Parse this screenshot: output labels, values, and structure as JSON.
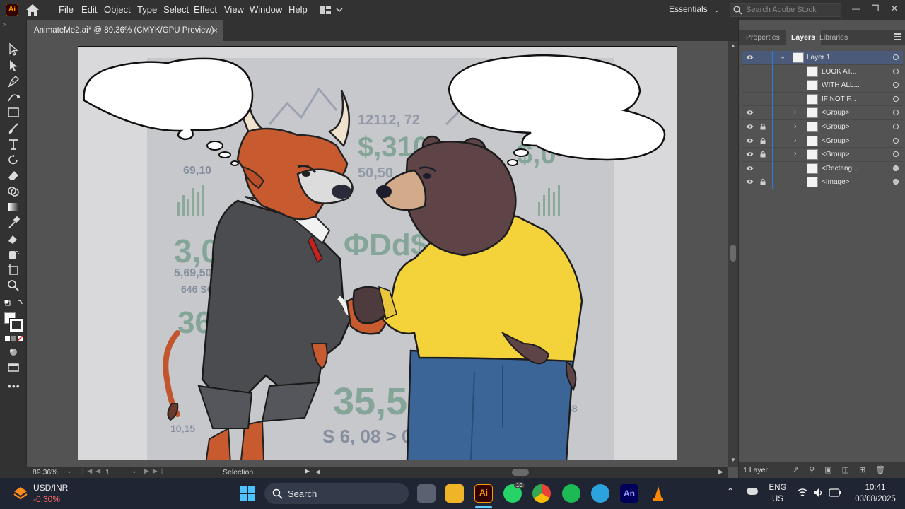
{
  "app": {
    "logo": "Ai",
    "menu": [
      "File",
      "Edit",
      "Object",
      "Type",
      "Select",
      "Effect",
      "View",
      "Window",
      "Help"
    ],
    "workspace": "Essentials",
    "stock_search_placeholder": "Search Adobe Stock"
  },
  "document": {
    "tab_title": "AnimateMe2.ai* @ 89.36% (CMYK/GPU Preview)",
    "close_glyph": "×"
  },
  "artwork": {
    "chart_text": [
      "12112, 72",
      "$,310",
      "50,50",
      "$,0",
      "69,10",
      "3,00",
      "5,69,50",
      "646 SO",
      "36",
      "ΦDd$",
      "35,56",
      "S 6, 08 > 0",
      "48",
      "10,15"
    ]
  },
  "status": {
    "zoom": "89.36%",
    "artboard_number": "1",
    "tool": "Selection"
  },
  "panel": {
    "tabs": [
      "Properties",
      "Layers",
      "Libraries"
    ],
    "active_tab": "Layers",
    "layers": [
      {
        "name": "Layer 1",
        "visible": true,
        "locked": false,
        "expand": "v",
        "indent": 0
      },
      {
        "name": "LOOK AT...",
        "visible": false,
        "locked": false,
        "expand": "",
        "indent": 1
      },
      {
        "name": "WITH ALL...",
        "visible": false,
        "locked": false,
        "expand": "",
        "indent": 1
      },
      {
        "name": "IF NOT F...",
        "visible": false,
        "locked": false,
        "expand": "",
        "indent": 1
      },
      {
        "name": "<Group>",
        "visible": true,
        "locked": false,
        "expand": ">",
        "indent": 1
      },
      {
        "name": "<Group>",
        "visible": true,
        "locked": true,
        "expand": ">",
        "indent": 1
      },
      {
        "name": "<Group>",
        "visible": true,
        "locked": true,
        "expand": ">",
        "indent": 1
      },
      {
        "name": "<Group>",
        "visible": true,
        "locked": true,
        "expand": ">",
        "indent": 1
      },
      {
        "name": "<Rectang...",
        "visible": true,
        "locked": false,
        "expand": "",
        "indent": 1
      },
      {
        "name": "<Image>",
        "visible": true,
        "locked": true,
        "expand": "",
        "indent": 1
      }
    ],
    "footer_count": "1 Layer"
  },
  "taskbar": {
    "ticker_name": "USD/INR",
    "ticker_change": "-0.30%",
    "search_placeholder": "Search",
    "whatsapp_badge": "10",
    "language": "ENG",
    "region": "US",
    "time": "10:41",
    "date": "03/08/2025"
  },
  "colors": {
    "ui_dark": "#323232",
    "ui_mid": "#535353",
    "accent_blue": "#2f7bd8",
    "ai_orange": "#ff9a00",
    "negative": "#ff6a6a"
  }
}
